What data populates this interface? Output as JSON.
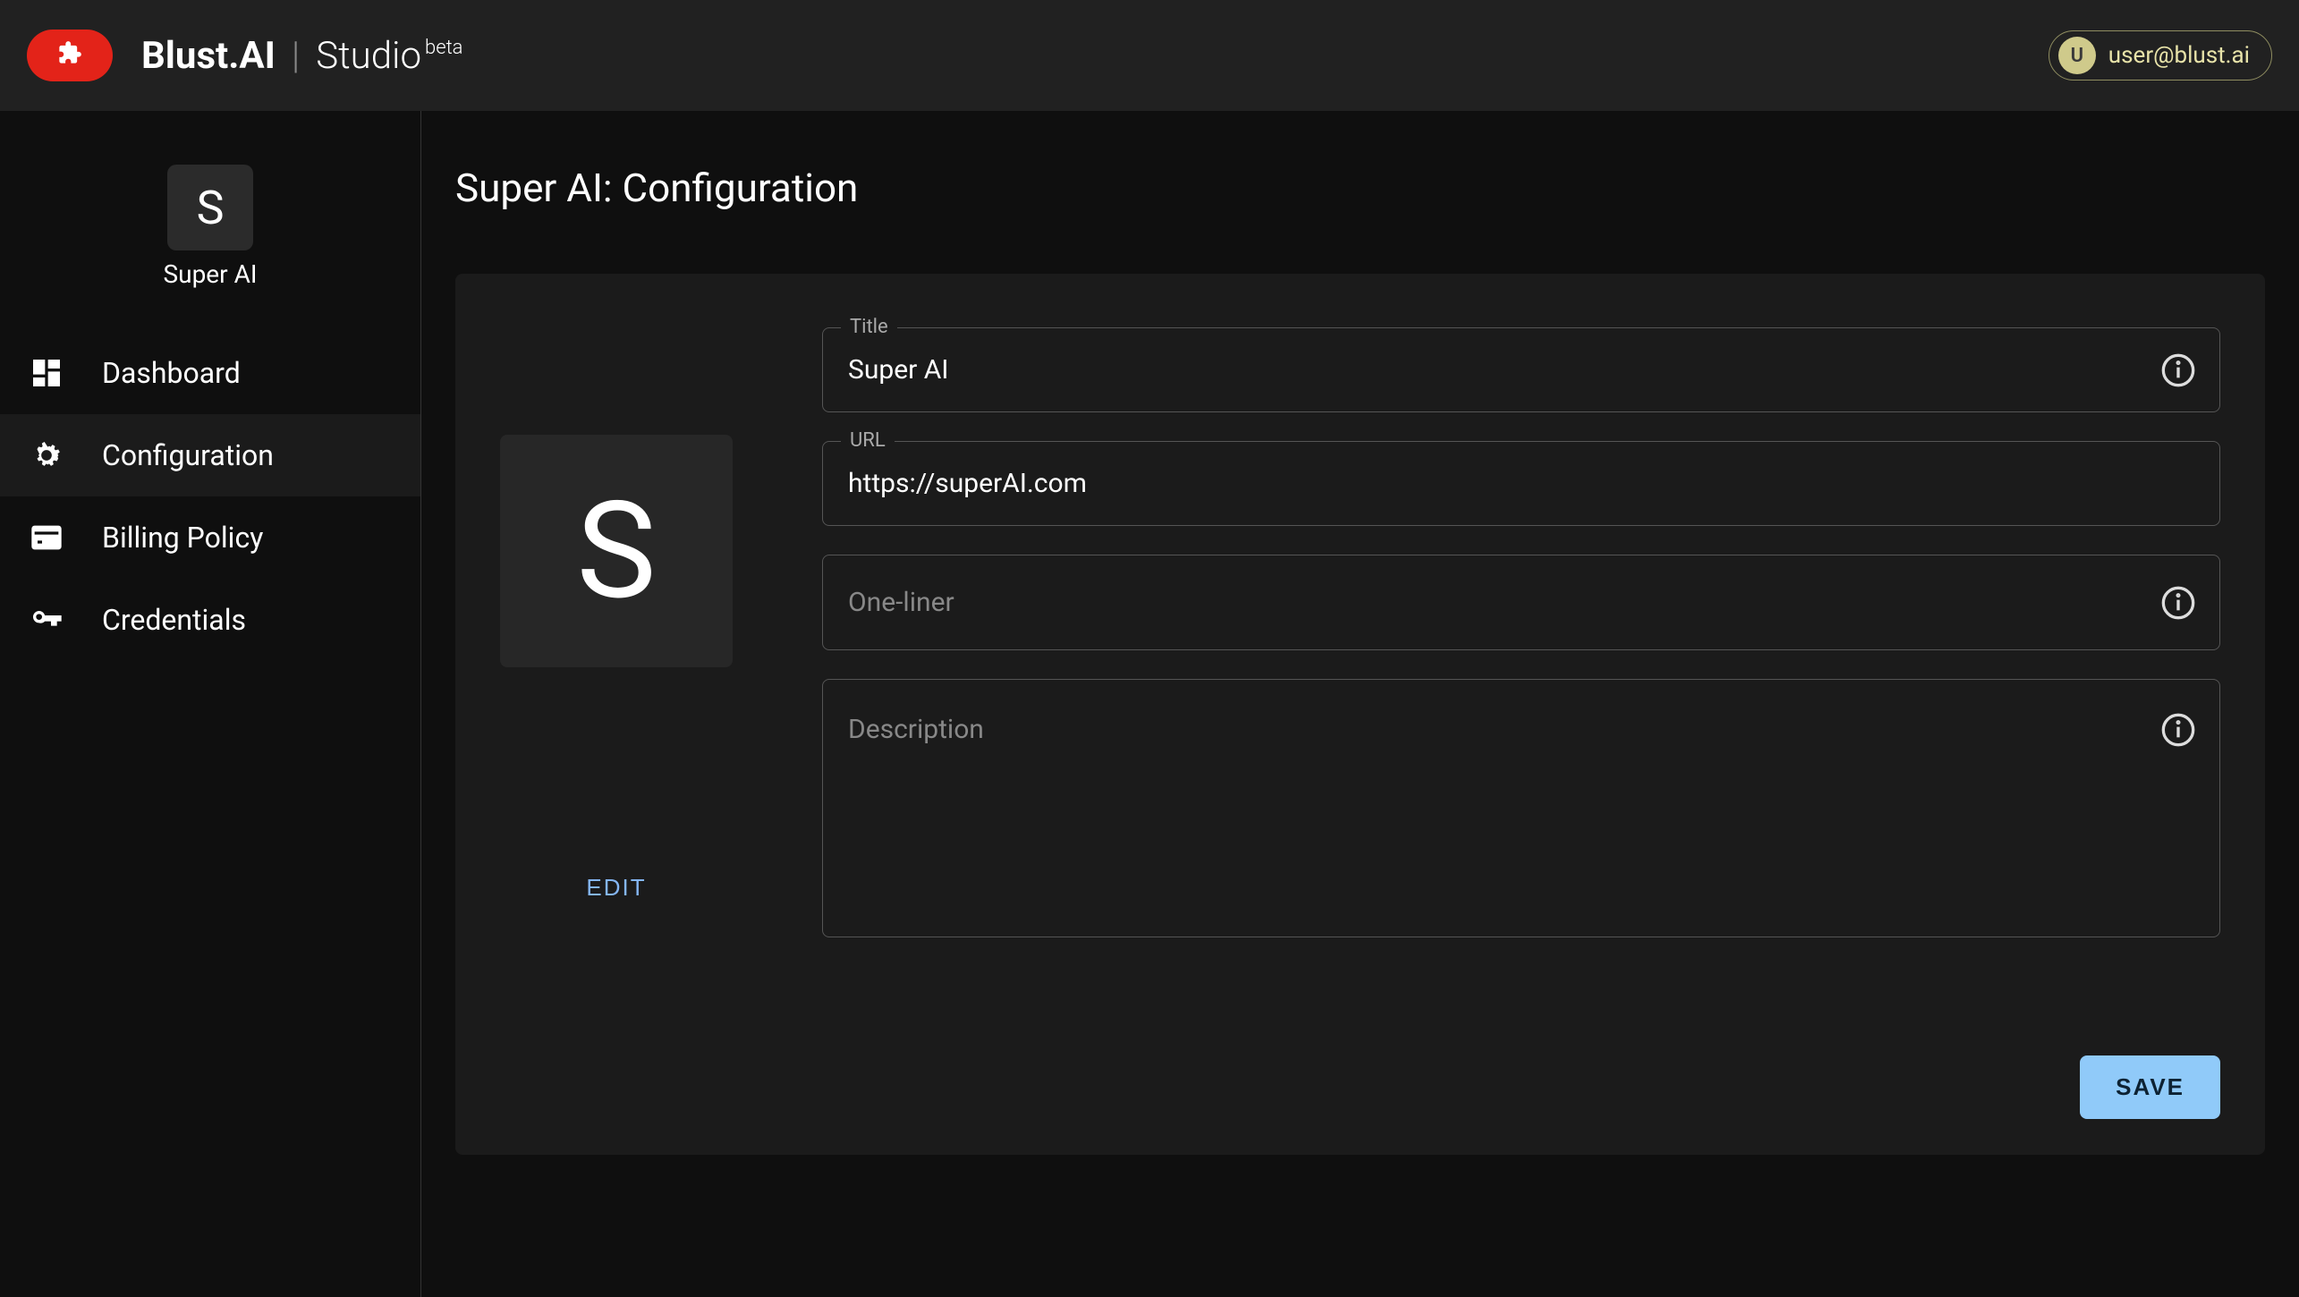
{
  "header": {
    "brand_main": "Blust.AI",
    "brand_sep": "|",
    "brand_studio": "Studio",
    "brand_beta": "beta",
    "user_initial": "U",
    "user_email": "user@blust.ai"
  },
  "sidebar": {
    "project_initial": "S",
    "project_name": "Super AI",
    "items": [
      {
        "label": "Dashboard",
        "icon": "dashboard-icon",
        "active": false
      },
      {
        "label": "Configuration",
        "icon": "gear-icon",
        "active": true
      },
      {
        "label": "Billing Policy",
        "icon": "billing-icon",
        "active": false
      },
      {
        "label": "Credentials",
        "icon": "key-icon",
        "active": false
      }
    ]
  },
  "main": {
    "page_title": "Super AI: Configuration",
    "avatar_initial": "S",
    "edit_label": "EDIT",
    "fields": {
      "title_label": "Title",
      "title_value": "Super AI",
      "url_label": "URL",
      "url_value": "https://superAI.com",
      "oneliner_placeholder": "One-liner",
      "oneliner_value": "",
      "description_placeholder": "Description",
      "description_value": ""
    },
    "save_label": "SAVE"
  }
}
